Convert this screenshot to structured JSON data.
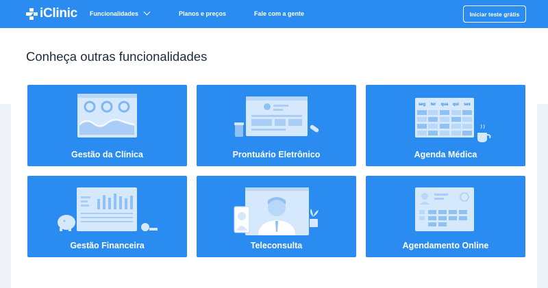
{
  "header": {
    "logo_text": "iClinic",
    "nav": [
      {
        "label": "Funcionalidades"
      },
      {
        "label": "Planos e preços"
      },
      {
        "label": "Fale com a gente"
      }
    ],
    "cta_label": "Iniciar teste grátis"
  },
  "main": {
    "title": "Conheça outras funcionalidades",
    "cards": [
      {
        "label": "Gestão da Clínica"
      },
      {
        "label": "Prontuário Eletrônico"
      },
      {
        "label": "Agenda Médica",
        "days": [
          "seg",
          "ter",
          "qua",
          "qui",
          "sex"
        ]
      },
      {
        "label": "Gestão Financeira"
      },
      {
        "label": "Teleconsulta"
      },
      {
        "label": "Agendamento Online"
      }
    ]
  },
  "colors": {
    "brand": "#2a8cf0",
    "illustration_light": "#cfe4fb",
    "page_bg": "#eef3fa",
    "text_dark": "#1d2b3a"
  },
  "icons": [
    "logo-mark-icon",
    "chevron-down-icon"
  ]
}
